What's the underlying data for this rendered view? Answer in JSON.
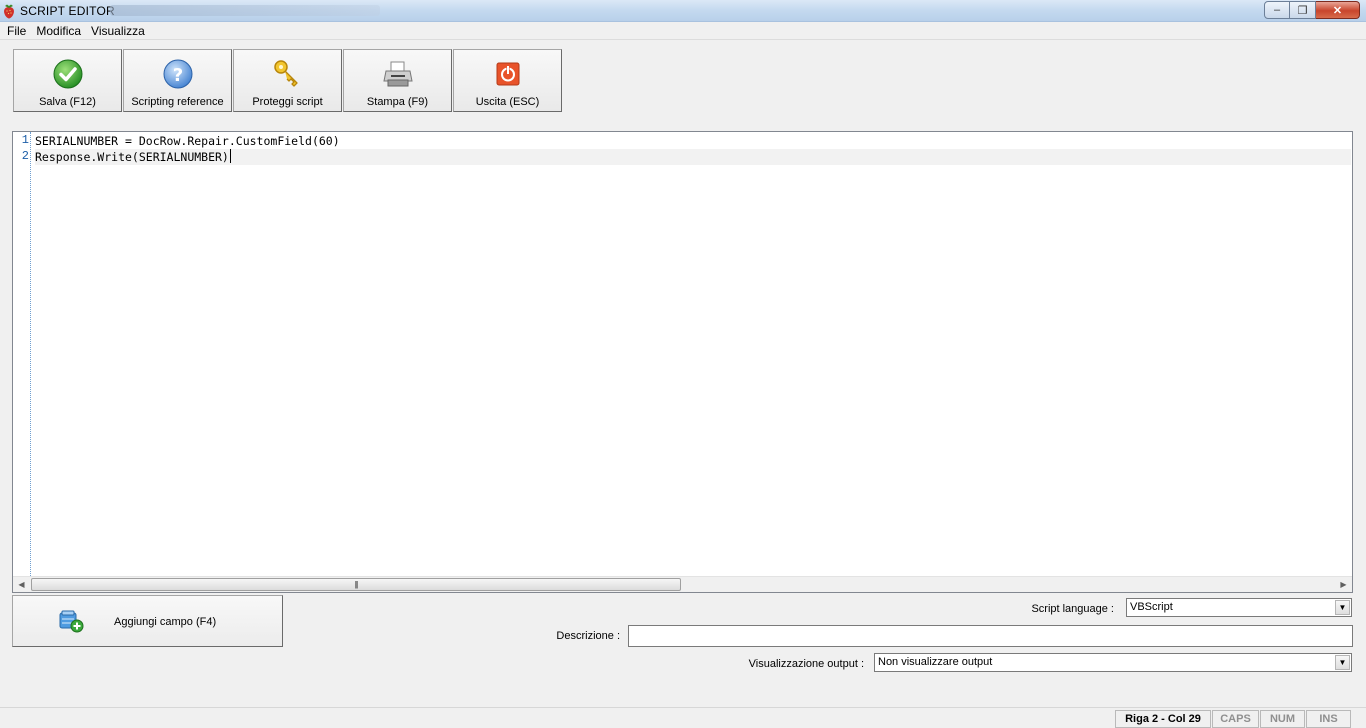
{
  "window": {
    "title": "SCRIPT EDITOR",
    "minimize_label": "–",
    "maximize_label": "❐",
    "close_label": "✕"
  },
  "menu": {
    "items": [
      "File",
      "Modifica",
      "Visualizza"
    ]
  },
  "toolbar": {
    "buttons": [
      {
        "label": "Salva (F12)",
        "icon": "check-icon"
      },
      {
        "label": "Scripting reference",
        "icon": "help-icon"
      },
      {
        "label": "Proteggi script",
        "icon": "key-icon"
      },
      {
        "label": "Stampa (F9)",
        "icon": "printer-icon"
      },
      {
        "label": "Uscita (ESC)",
        "icon": "power-icon"
      }
    ]
  },
  "editor": {
    "lines": [
      {
        "number": "1",
        "text": "SERIALNUMBER = DocRow.Repair.CustomField(60)"
      },
      {
        "number": "2",
        "text": "Response.Write(SERIALNUMBER)"
      }
    ],
    "scroll_left": "◀",
    "scroll_right": "▶",
    "scroll_grip": "|||"
  },
  "add_field": {
    "label": "Aggiungi campo (F4)"
  },
  "form": {
    "language_label": "Script language :",
    "language_value": "VBScript",
    "description_label": "Descrizione :",
    "description_value": "",
    "output_label": "Visualizzazione output :",
    "output_value": "Non visualizzare output",
    "dropdown_arrow": "▼"
  },
  "status": {
    "position": "Riga 2 - Col 29",
    "caps": "CAPS",
    "num": "NUM",
    "ins": "INS"
  }
}
